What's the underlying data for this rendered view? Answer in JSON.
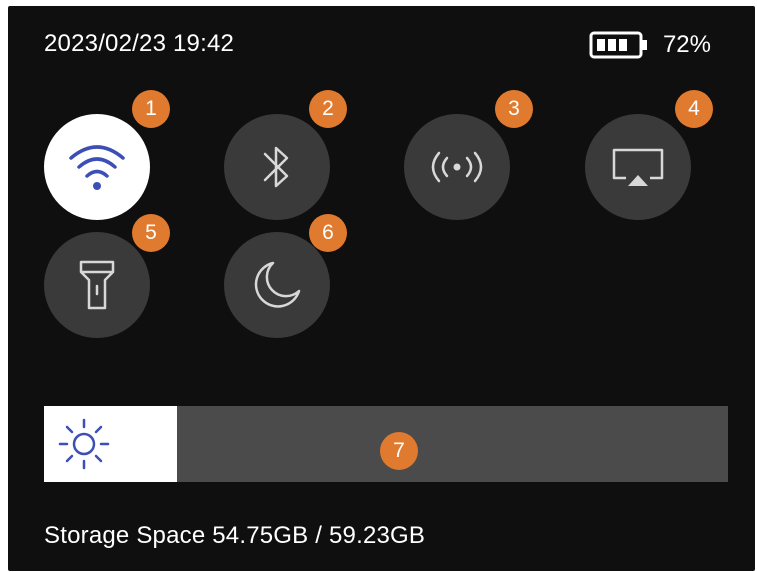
{
  "status": {
    "datetime": "2023/02/23 19:42",
    "battery_percent": "72%",
    "battery_icon": "battery-icon",
    "battery_level": 0.72
  },
  "tiles": [
    {
      "id": "wifi",
      "icon": "wifi-icon",
      "active": true,
      "badge": "1"
    },
    {
      "id": "bluetooth",
      "icon": "bluetooth-icon",
      "active": false,
      "badge": "2"
    },
    {
      "id": "hotspot",
      "icon": "hotspot-icon",
      "active": false,
      "badge": "3"
    },
    {
      "id": "screen-cast",
      "icon": "screen-cast-icon",
      "active": false,
      "badge": "4"
    },
    {
      "id": "flashlight",
      "icon": "flashlight-icon",
      "active": false,
      "badge": "5"
    },
    {
      "id": "night-mode",
      "icon": "moon-icon",
      "active": false,
      "badge": "6"
    }
  ],
  "brightness": {
    "icon": "sun-icon",
    "level": 0.195,
    "badge": "7"
  },
  "storage": {
    "text": "Storage Space 54.75GB / 59.23GB"
  },
  "colors": {
    "background": "#0f0f0f",
    "tile_inactive": "#3a3a3a",
    "tile_active": "#ffffff",
    "accent_icon": "#3d4fb5",
    "badge": "#e07a2f",
    "slider_track": "#4b4b4b"
  }
}
